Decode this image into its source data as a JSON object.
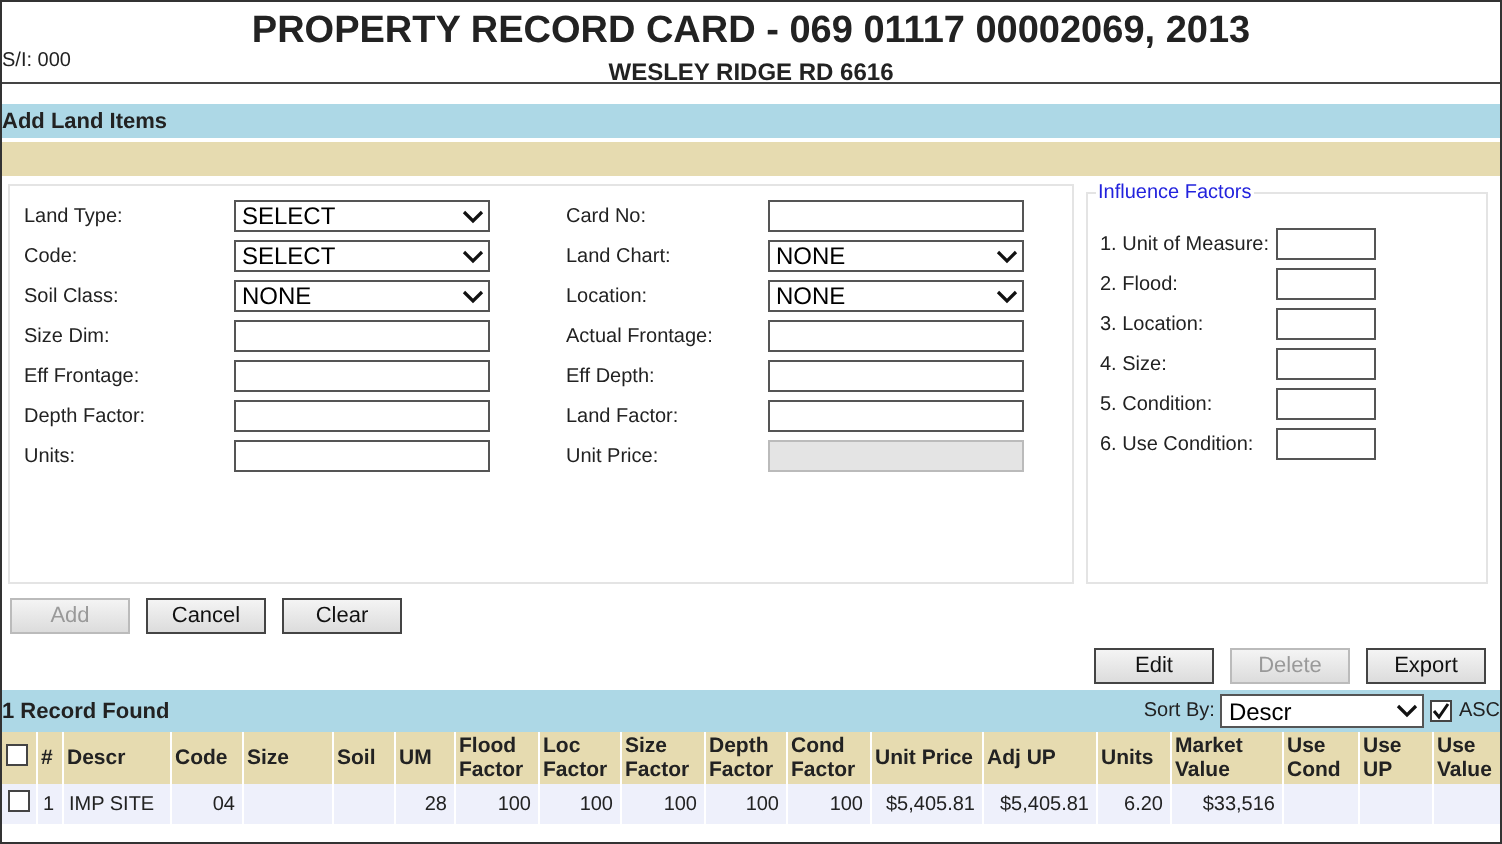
{
  "header": {
    "title": "PROPERTY RECORD CARD - 069 01117 00002069, 2013",
    "si": "S/I: 000",
    "subtitle": "WESLEY RIDGE RD 6616"
  },
  "section_title": "Add Land Items",
  "form": {
    "left": [
      {
        "label": "Land Type:",
        "kind": "select",
        "value": "SELECT"
      },
      {
        "label": "Code:",
        "kind": "select",
        "value": "SELECT"
      },
      {
        "label": "Soil Class:",
        "kind": "select",
        "value": "NONE"
      },
      {
        "label": "Size Dim:",
        "kind": "text",
        "disabled": false
      },
      {
        "label": "Eff Frontage:",
        "kind": "text",
        "disabled": false
      },
      {
        "label": "Depth Factor:",
        "kind": "text",
        "disabled": false
      },
      {
        "label": "Units:",
        "kind": "text",
        "disabled": false
      }
    ],
    "right": [
      {
        "label": "Card No:",
        "kind": "text",
        "disabled": false
      },
      {
        "label": "Land Chart:",
        "kind": "select",
        "value": "NONE"
      },
      {
        "label": "Location:",
        "kind": "select",
        "value": "NONE"
      },
      {
        "label": "Actual Frontage:",
        "kind": "text",
        "disabled": false
      },
      {
        "label": "Eff Depth:",
        "kind": "text",
        "disabled": false
      },
      {
        "label": "Land Factor:",
        "kind": "text",
        "disabled": false
      },
      {
        "label": "Unit Price:",
        "kind": "text",
        "disabled": true
      }
    ]
  },
  "influence_factors": {
    "legend": "Influence Factors",
    "items": [
      "1. Unit of Measure:",
      "2. Flood:",
      "3. Location:",
      "4. Size:",
      "5. Condition:",
      "6. Use Condition:"
    ]
  },
  "form_buttons": [
    {
      "label": "Add",
      "disabled": true
    },
    {
      "label": "Cancel",
      "disabled": false
    },
    {
      "label": "Clear",
      "disabled": false
    }
  ],
  "table_buttons": [
    {
      "label": "Edit",
      "disabled": false
    },
    {
      "label": "Delete",
      "disabled": true
    },
    {
      "label": "Export",
      "disabled": false
    }
  ],
  "records": {
    "count": "1 Record Found",
    "sort_label": "Sort By:",
    "sort_value": "Descr",
    "asc_label": "ASC",
    "asc_checked": true
  },
  "table": {
    "select_all_checked": false,
    "columns": [
      "#",
      "Descr",
      "Code",
      "Size",
      "Soil",
      "UM",
      "Flood Factor",
      "Loc Factor",
      "Size Factor",
      "Depth Factor",
      "Cond Factor",
      "Unit Price",
      "Adj UP",
      "Units",
      "Market Value",
      "Use Cond",
      "Use UP",
      "Use Value"
    ],
    "rows": [
      {
        "checked": false,
        "cells": [
          "1",
          "IMP SITE",
          "04",
          "",
          "",
          "28",
          "100",
          "100",
          "100",
          "100",
          "100",
          "$5,405.81",
          "$5,405.81",
          "6.20",
          "$33,516",
          "",
          "",
          ""
        ]
      }
    ]
  }
}
